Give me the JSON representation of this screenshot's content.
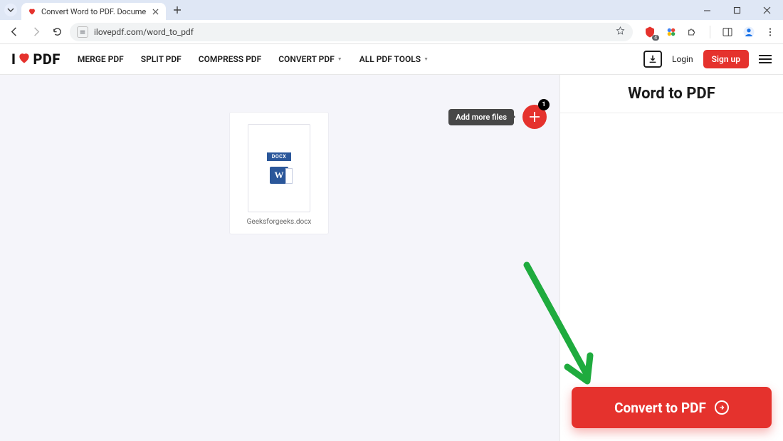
{
  "browser": {
    "tab_title": "Convert Word to PDF. Docume",
    "url": "ilovepdf.com/word_to_pdf"
  },
  "header": {
    "logo_prefix": "I",
    "logo_suffix": "PDF",
    "nav": {
      "merge": "MERGE PDF",
      "split": "SPLIT PDF",
      "compress": "COMPRESS PDF",
      "convert": "CONVERT PDF",
      "all_tools": "ALL PDF TOOLS"
    },
    "login": "Login",
    "signup": "Sign up"
  },
  "canvas": {
    "file": {
      "name": "Geeksforgeeks.docx",
      "badge": "DOCX",
      "w_letter": "W"
    },
    "add_more": {
      "tooltip": "Add more files",
      "count": "1"
    }
  },
  "panel": {
    "title": "Word to PDF",
    "convert_label": "Convert to PDF"
  }
}
